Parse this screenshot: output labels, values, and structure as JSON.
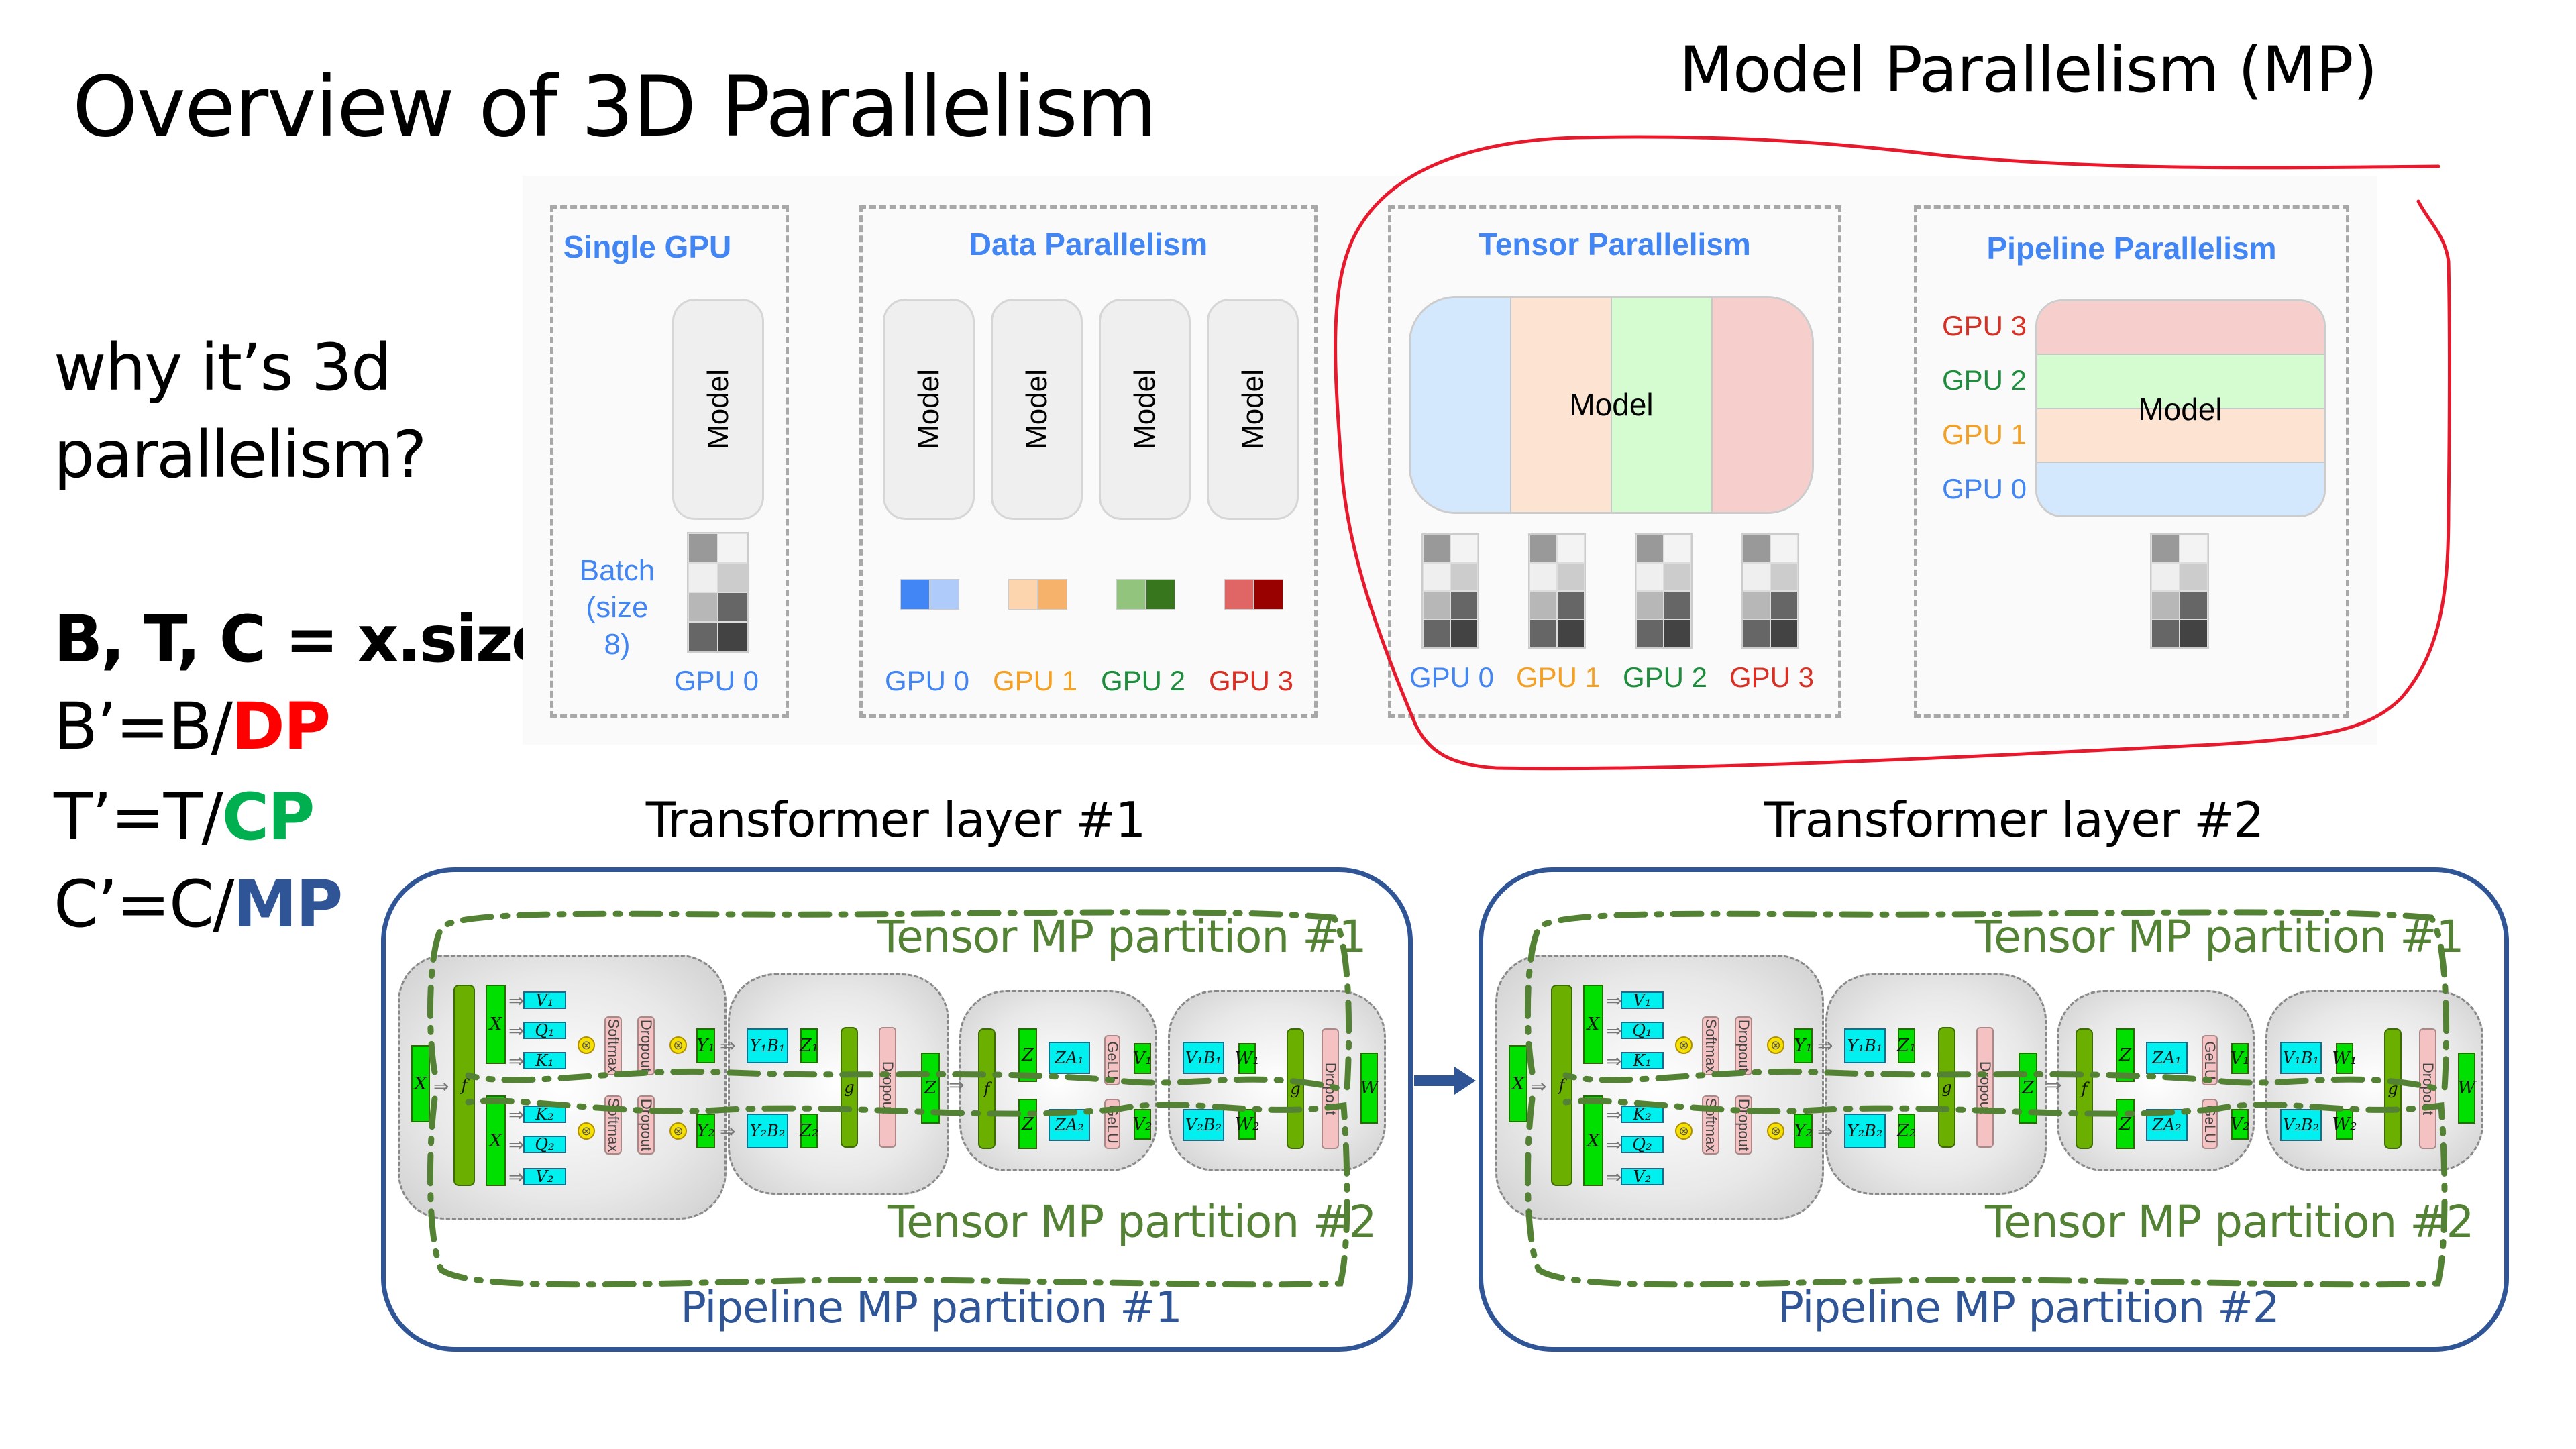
{
  "slide": {
    "title": "Overview of 3D Parallelism",
    "mp_heading": "Model Parallelism (MP)"
  },
  "left_text": {
    "question_line1": "why it’s 3d",
    "question_line2": "parallelism?",
    "shape_line": "B, T, C = x.size()",
    "b_prefix": "B’=B/",
    "b_factor": "DP",
    "t_prefix": "T’=T/",
    "t_factor": "CP",
    "c_prefix": "C’=C/",
    "c_factor": "MP"
  },
  "colors": {
    "dp": "#ff0000",
    "cp": "#00b050",
    "mp": "#2f5597",
    "annotation_red": "#e8192c",
    "gpu0": "#4285f4",
    "gpu1": "#f4a025",
    "gpu2": "#1e8e3e",
    "gpu3": "#d93025",
    "tensor_partition": "#548235",
    "pipeline_partition": "#2f5597"
  },
  "parallelism_panel": {
    "single_gpu": {
      "title": "Single GPU",
      "model_label": "Model",
      "batch_label_line1": "Batch",
      "batch_label_line2": "(size 8)",
      "gpu_label": "GPU 0"
    },
    "data_parallelism": {
      "title": "Data Parallelism",
      "replicas": [
        {
          "model_label": "Model",
          "gpu_label": "GPU 0",
          "batch_colors": [
            "#4285f4",
            "#aecbfa"
          ]
        },
        {
          "model_label": "Model",
          "gpu_label": "GPU 1",
          "batch_colors": [
            "#fcd5ae",
            "#f6b26b"
          ]
        },
        {
          "model_label": "Model",
          "gpu_label": "GPU 2",
          "batch_colors": [
            "#93c47d",
            "#38761d"
          ]
        },
        {
          "model_label": "Model",
          "gpu_label": "GPU 3",
          "batch_colors": [
            "#e06666",
            "#990000"
          ]
        }
      ]
    },
    "tensor_parallelism": {
      "title": "Tensor Parallelism",
      "model_label": "Model",
      "shard_colors": [
        "#d3e7fd",
        "#fde3d1",
        "#d5fcd0",
        "#f6cfcd"
      ],
      "gpu_labels": [
        "GPU 0",
        "GPU 1",
        "GPU 2",
        "GPU 3"
      ]
    },
    "pipeline_parallelism": {
      "title": "Pipeline Parallelism",
      "model_label": "Model",
      "stages": [
        {
          "gpu_label": "GPU 3",
          "color": "#f6cfcd"
        },
        {
          "gpu_label": "GPU 2",
          "color": "#d5fcd0"
        },
        {
          "gpu_label": "GPU 1",
          "color": "#fde3d1"
        },
        {
          "gpu_label": "GPU 0",
          "color": "#d3e7fd"
        }
      ]
    },
    "batch_shades": [
      "#999999",
      "#f3f3f3",
      "#efefef",
      "#cccccc",
      "#b7b7b7",
      "#666666",
      "#666666",
      "#434343"
    ]
  },
  "transformer_layers": [
    {
      "title": "Transformer layer #1",
      "tensor_partition_1": "Tensor MP partition #1",
      "tensor_partition_2": "Tensor MP partition #2",
      "pipeline_partition": "Pipeline MP partition #1"
    },
    {
      "title": "Transformer layer #2",
      "tensor_partition_1": "Tensor MP partition #1",
      "tensor_partition_2": "Tensor MP partition #2",
      "pipeline_partition": "Pipeline MP partition #2"
    }
  ],
  "transformer_diagram_labels": {
    "input": "X",
    "f": "f",
    "g": "g",
    "x_split": "X",
    "v1": "V₁",
    "q1": "Q₁",
    "k1": "K₁",
    "k2": "K₂",
    "q2": "Q₂",
    "v2": "V₂",
    "softmax": "Softmax",
    "dropout": "Dropout",
    "y1": "Y₁",
    "y2": "Y₂",
    "y1b1": "Y₁B₁",
    "y2b2": "Y₂B₂",
    "z1": "Z₁",
    "z2": "Z₂",
    "z": "Z",
    "za1": "ZA₁",
    "za2": "ZA₂",
    "gelu": "GeLU",
    "v1_out": "V₁",
    "v2_out": "V₂",
    "v1b1": "V₁B₁",
    "v2b2": "V₂B₂",
    "w1": "W₁",
    "w2": "W₂",
    "w": "W"
  }
}
